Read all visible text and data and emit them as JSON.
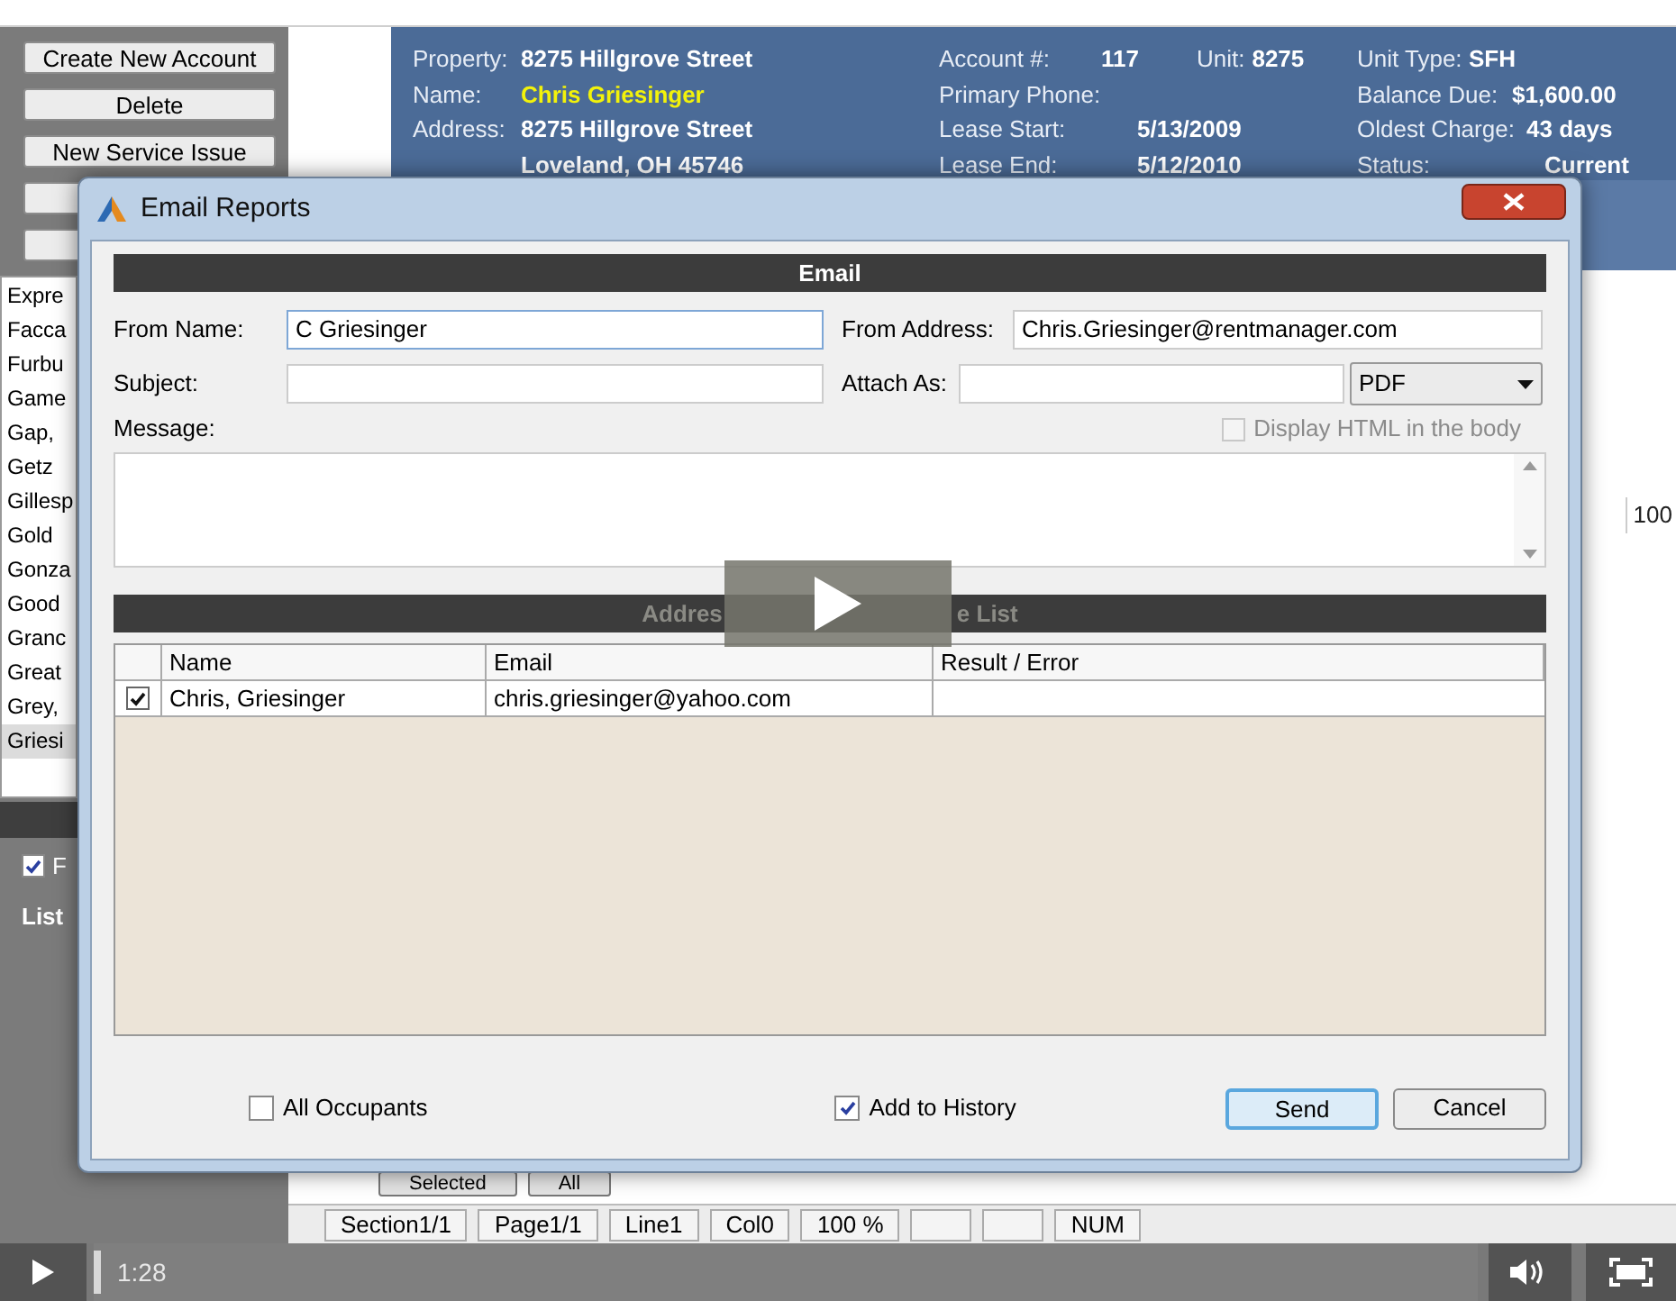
{
  "app": {
    "side_buttons": [
      {
        "label": "Create New Account"
      },
      {
        "label": "Delete"
      },
      {
        "label": "New Service Issue"
      }
    ],
    "header": {
      "columns": [
        [
          {
            "label": "Property:",
            "value": "8275 Hillgrove Street",
            "highlight": false
          },
          {
            "label": "Name:",
            "value": "Chris Griesinger",
            "highlight": true
          },
          {
            "label": "Address:",
            "value": "8275 Hillgrove Street",
            "highlight": false
          },
          {
            "value": "Loveland, OH 45746",
            "highlight": false
          }
        ],
        [
          {
            "label": "Account #:",
            "value": "117",
            "extra_label": "Unit:",
            "extra_value": "8275",
            "highlight": false
          },
          {
            "label": "Primary Phone:"
          },
          {
            "label": "Lease Start:",
            "value": "5/13/2009",
            "highlight": false
          },
          {
            "label": "Lease End:",
            "value": "5/12/2010",
            "highlight": false
          }
        ],
        [
          {
            "label": "Unit Type:",
            "value": "SFH",
            "highlight": false
          },
          {
            "label": "Balance Due:",
            "value": "$1,600.00",
            "highlight": false
          },
          {
            "label": "Oldest Charge:",
            "value": "43 days",
            "highlight": false
          },
          {
            "label": "Status:",
            "value": "Current",
            "highlight": false
          }
        ]
      ]
    },
    "tenant_list": [
      {
        "text": "Expre",
        "selected": false
      },
      {
        "text": "Facca",
        "selected": false
      },
      {
        "text": "Furbu",
        "selected": false
      },
      {
        "text": "Game",
        "selected": false
      },
      {
        "text": "Gap,",
        "selected": false
      },
      {
        "text": "Getz",
        "selected": false
      },
      {
        "text": "Gillesp",
        "selected": false
      },
      {
        "text": "Gold",
        "selected": false
      },
      {
        "text": "Gonza",
        "selected": false
      },
      {
        "text": "Good",
        "selected": false
      },
      {
        "text": "Granc",
        "selected": false
      },
      {
        "text": "Great",
        "selected": false
      },
      {
        "text": "Grey,",
        "selected": false
      },
      {
        "text": "Griesi",
        "selected": true
      }
    ],
    "filter": {
      "label": "F",
      "checked": true
    },
    "list_label": "List",
    "zoom_fragment": "100",
    "bottom_tabs": [
      "Selected",
      "All"
    ],
    "status_bar": [
      {
        "text": "Section1/1"
      },
      {
        "text": "Page1/1"
      },
      {
        "text": "Line1"
      },
      {
        "text": "Col0"
      },
      {
        "text": "100 %"
      },
      {
        "kind": "blank"
      },
      {
        "kind": "blank"
      },
      {
        "text": "NUM"
      }
    ]
  },
  "dialog": {
    "title": "Email Reports",
    "section": "Email",
    "from_name": {
      "label": "From Name:",
      "value": "C Griesinger"
    },
    "from_address": {
      "label": "From Address:",
      "value": "Chris.Griesinger@rentmanager.com"
    },
    "subject": {
      "label": "Subject:"
    },
    "attach_as": {
      "label": "Attach As:"
    },
    "format": {
      "value": "PDF"
    },
    "message": {
      "label": "Message:"
    },
    "display_html": {
      "label": "Display HTML in the body",
      "checked": false,
      "disabled": true
    },
    "addressee_section": [
      "Addres",
      "e List"
    ],
    "table": {
      "columns": [
        "Name",
        "Email",
        "Result / Error"
      ],
      "rows": [
        {
          "checked": true,
          "name": "Chris, Griesinger",
          "email": "chris.griesinger@yahoo.com"
        }
      ]
    },
    "all_occupants": {
      "label": "All Occupants",
      "checked": false
    },
    "add_to_history": {
      "label": "Add to History",
      "checked": true
    },
    "buttons": [
      {
        "label": "Send",
        "default": true
      },
      {
        "label": "Cancel",
        "default": false
      }
    ]
  },
  "player": {
    "time": "1:28"
  }
}
